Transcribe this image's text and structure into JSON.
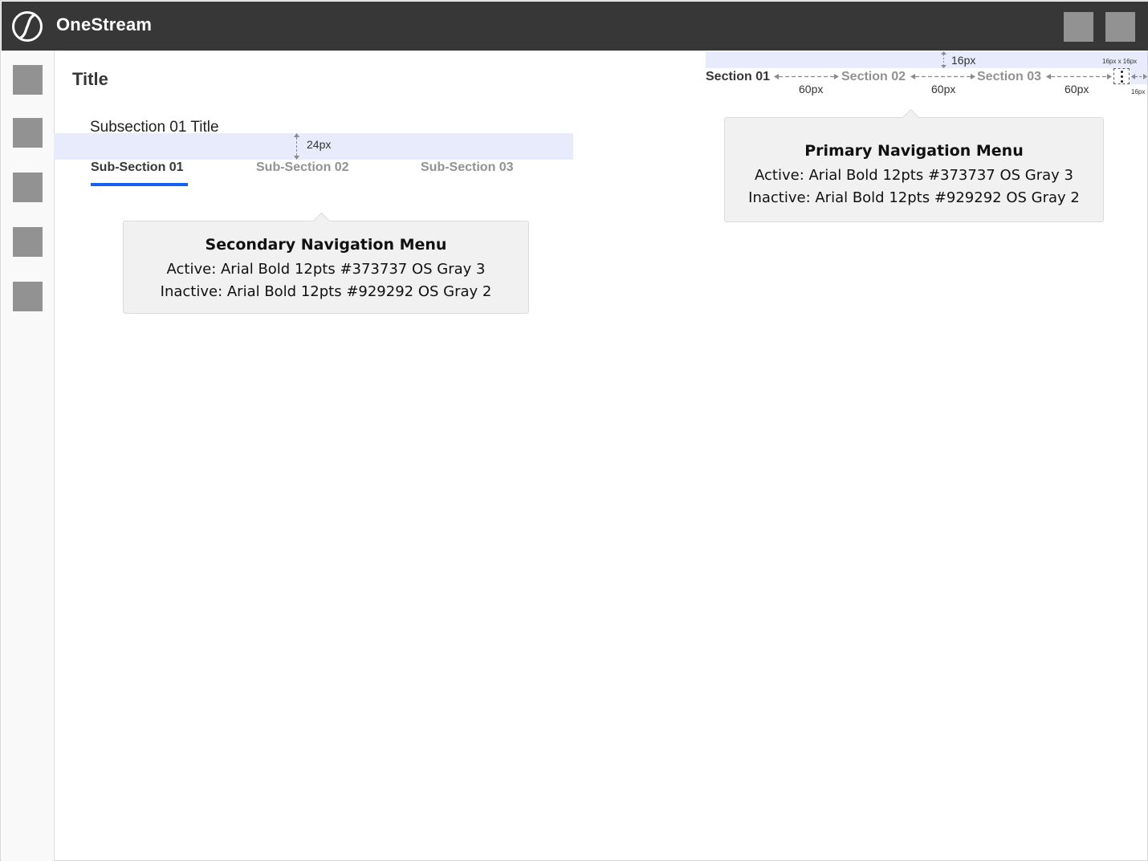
{
  "app": {
    "name": "OneStream"
  },
  "page": {
    "title": "Title"
  },
  "secondary_nav": {
    "subsection_title": "Subsection 01 Title",
    "spacing_label": "24px",
    "tabs": [
      {
        "label": "Sub-Section 01",
        "active": true
      },
      {
        "label": "Sub-Section 02",
        "active": false
      },
      {
        "label": "Sub-Section 03",
        "active": false
      }
    ]
  },
  "primary_nav": {
    "tabs": [
      {
        "label": "Section 01",
        "active": true
      },
      {
        "label": "Section 02",
        "active": false
      },
      {
        "label": "Section 03",
        "active": false
      }
    ],
    "top_spacing_label": "16px",
    "gap_labels": [
      "60px",
      "60px",
      "60px"
    ],
    "more_size_label": "16px x 16px",
    "right_spacing_label": "16px"
  },
  "annotations": {
    "secondary": {
      "title": "Secondary Navigation Menu",
      "active": "Active: Arial Bold 12pts  #373737  OS Gray 3",
      "inactive": "Inactive: Arial Bold 12pts  #929292  OS Gray 2"
    },
    "primary": {
      "title": "Primary Navigation Menu",
      "active": "Active: Arial Bold 12pts  #373737  OS Gray 3",
      "inactive": "Inactive: Arial Bold 12pts  #929292  OS Gray 2"
    }
  },
  "colors": {
    "header_bg": "#373737",
    "active_text": "#373737",
    "inactive_text": "#929292",
    "accent_underline": "#1761f0",
    "spacing_highlight": "#e8ebfb",
    "placeholder_gray": "#929292"
  },
  "icons": {
    "logo": "onestream-logo-icon",
    "more": "more-vertical-icon"
  }
}
